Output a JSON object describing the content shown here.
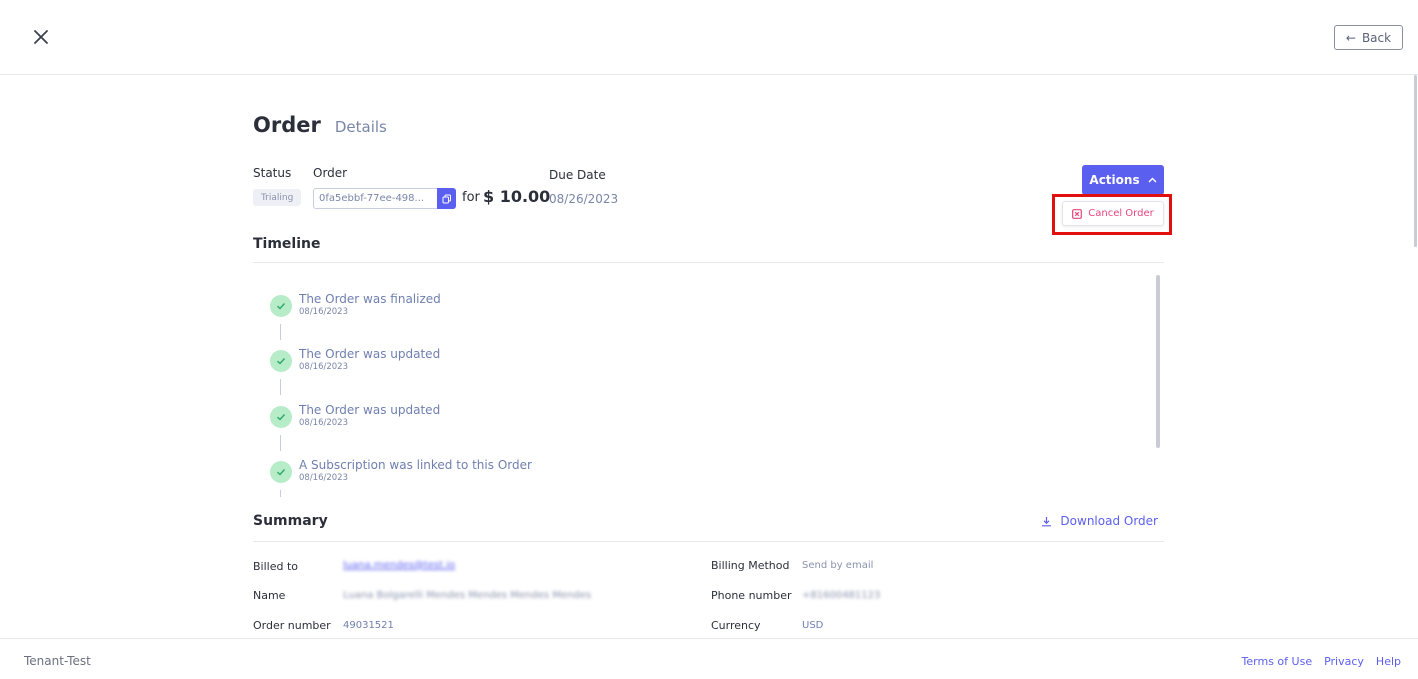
{
  "header": {
    "back_label": "Back"
  },
  "page": {
    "title": "Order",
    "subtitle": "Details"
  },
  "order_info": {
    "status_label": "Status",
    "order_label": "Order",
    "due_label": "Due Date",
    "status_value": "Trialing",
    "order_id": "0fa5ebbf-77ee-498...",
    "for_text": "for",
    "amount": "$ 10.00",
    "due_value": "08/26/2023"
  },
  "actions": {
    "label": "Actions",
    "cancel_label": "Cancel Order"
  },
  "timeline": {
    "title": "Timeline",
    "items": [
      {
        "text": "The Order was finalized",
        "date": "08/16/2023"
      },
      {
        "text": "The Order was updated",
        "date": "08/16/2023"
      },
      {
        "text": "The Order was updated",
        "date": "08/16/2023"
      },
      {
        "text": "A Subscription was linked to this Order",
        "date": "08/16/2023"
      }
    ]
  },
  "summary": {
    "title": "Summary",
    "download_label": "Download Order",
    "billed_to_label": "Billed to",
    "billed_to_value": "luana.mendes@test.io",
    "name_label": "Name",
    "name_value": "Luana Bolgarelli Mendes Mendes Mendes Mendes",
    "order_number_label": "Order number",
    "order_number_value": "49031521",
    "billing_method_label": "Billing Method",
    "billing_method_value": "Send by email",
    "phone_label": "Phone number",
    "phone_value": "+81600481123",
    "currency_label": "Currency",
    "currency_value": "USD"
  },
  "footer": {
    "tenant": "Tenant-Test",
    "terms": "Terms of Use",
    "privacy": "Privacy",
    "help": "Help"
  },
  "colors": {
    "primary": "#5b5ff0",
    "danger": "#e8457a",
    "highlight": "#e20f0f",
    "success_bg": "#b6ecc8"
  }
}
